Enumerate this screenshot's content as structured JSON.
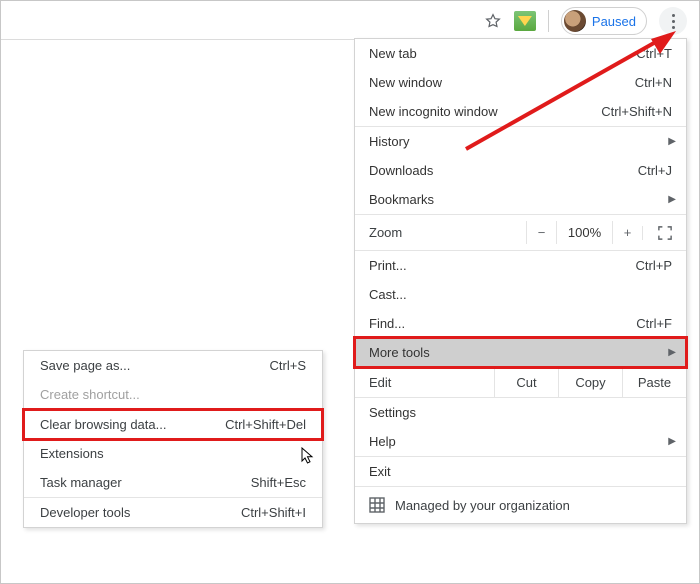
{
  "toolbar": {
    "paused_label": "Paused"
  },
  "menu": {
    "new_tab": {
      "label": "New tab",
      "short": "Ctrl+T"
    },
    "new_window": {
      "label": "New window",
      "short": "Ctrl+N"
    },
    "incognito": {
      "label": "New incognito window",
      "short": "Ctrl+Shift+N"
    },
    "history": {
      "label": "History"
    },
    "downloads": {
      "label": "Downloads",
      "short": "Ctrl+J"
    },
    "bookmarks": {
      "label": "Bookmarks"
    },
    "zoom": {
      "label": "Zoom",
      "minus": "−",
      "pct": "100%",
      "plus": "+"
    },
    "print": {
      "label": "Print...",
      "short": "Ctrl+P"
    },
    "cast": {
      "label": "Cast..."
    },
    "find": {
      "label": "Find...",
      "short": "Ctrl+F"
    },
    "more_tools": {
      "label": "More tools"
    },
    "edit": {
      "label": "Edit",
      "cut": "Cut",
      "copy": "Copy",
      "paste": "Paste"
    },
    "settings": {
      "label": "Settings"
    },
    "help": {
      "label": "Help"
    },
    "exit": {
      "label": "Exit"
    },
    "managed": {
      "label": "Managed by your organization"
    }
  },
  "submenu": {
    "save_page": {
      "label": "Save page as...",
      "short": "Ctrl+S"
    },
    "create_shortcut": {
      "label": "Create shortcut..."
    },
    "clear_browsing": {
      "label": "Clear browsing data...",
      "short": "Ctrl+Shift+Del"
    },
    "extensions": {
      "label": "Extensions"
    },
    "task_manager": {
      "label": "Task manager",
      "short": "Shift+Esc"
    },
    "dev_tools": {
      "label": "Developer tools",
      "short": "Ctrl+Shift+I"
    }
  }
}
